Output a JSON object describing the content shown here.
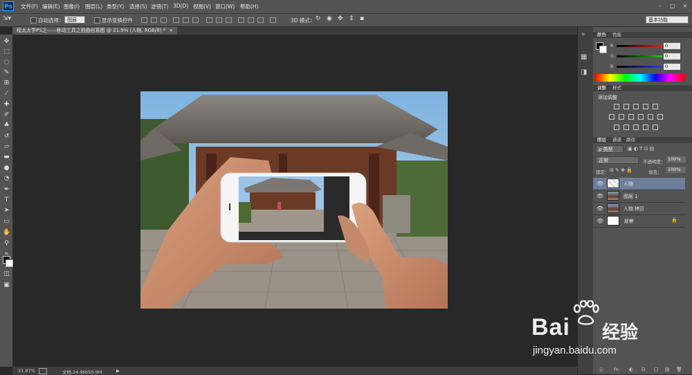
{
  "app": {
    "logo": "Ps"
  },
  "menu": [
    "文件(F)",
    "编辑(E)",
    "图像(I)",
    "图层(L)",
    "类型(Y)",
    "选择(S)",
    "滤镜(T)",
    "3D(D)",
    "视图(V)",
    "窗口(W)",
    "帮助(H)"
  ],
  "window_controls": [
    "–",
    "□",
    "×"
  ],
  "options_bar": {
    "auto_select_label": "自动选择：",
    "auto_select_value": "图层",
    "show_transform_label": "显示变换控件",
    "mode_3d_label": "3D 模式：",
    "workspace": "基本功能"
  },
  "document": {
    "tab_title": "程太太学PS之——移动工具之拍曲创意图 @ 21.9% (人物, RGB/8) *",
    "close_symbol": "×"
  },
  "status": {
    "zoom": "21.87%",
    "doc_info": "文档:24.9M/50.9M",
    "arrow": "▶"
  },
  "color_panel": {
    "tabs": [
      "颜色",
      "色板"
    ],
    "channels": [
      {
        "label": "R",
        "value": "0",
        "color": "#e02020"
      },
      {
        "label": "G",
        "value": "0",
        "color": "#20c020"
      },
      {
        "label": "B",
        "value": "0",
        "color": "#2040e0"
      }
    ]
  },
  "adjust_panel": {
    "tabs": [
      "调整",
      "样式"
    ],
    "heading": "添加调整"
  },
  "layers_panel": {
    "tabs": [
      "图层",
      "通道",
      "路径"
    ],
    "filter_kind": "ρ 类型",
    "blend_mode": "正常",
    "opacity_label": "不透明度：",
    "opacity_value": "100%",
    "lock_label": "锁定：",
    "fill_label": "填充：",
    "fill_value": "100%",
    "layers": [
      {
        "name": "人物",
        "selected": true
      },
      {
        "name": "图层 1",
        "selected": false
      },
      {
        "name": "人物 拷贝",
        "selected": false
      },
      {
        "name": "背景",
        "selected": false
      }
    ],
    "bottom_icons": [
      "ⓞ",
      "fx.",
      "◐",
      "⊡",
      "▢",
      "▤",
      "🗑"
    ]
  },
  "watermark": {
    "brand_text": "Bai",
    "brand_cn": "经验",
    "url": "jingyan.baidu.com"
  },
  "icons": [
    "move-tool-icon",
    "marquee-icon",
    "lasso-icon",
    "quick-select-icon",
    "crop-icon",
    "eyedropper-icon",
    "healing-brush-icon",
    "brush-icon",
    "clone-stamp-icon",
    "history-brush-icon",
    "eraser-icon",
    "gradient-icon",
    "blur-icon",
    "dodge-icon",
    "pen-icon",
    "type-icon",
    "path-select-icon",
    "shape-icon",
    "hand-icon",
    "zoom-icon",
    "eye-icon",
    "lock-icon"
  ]
}
